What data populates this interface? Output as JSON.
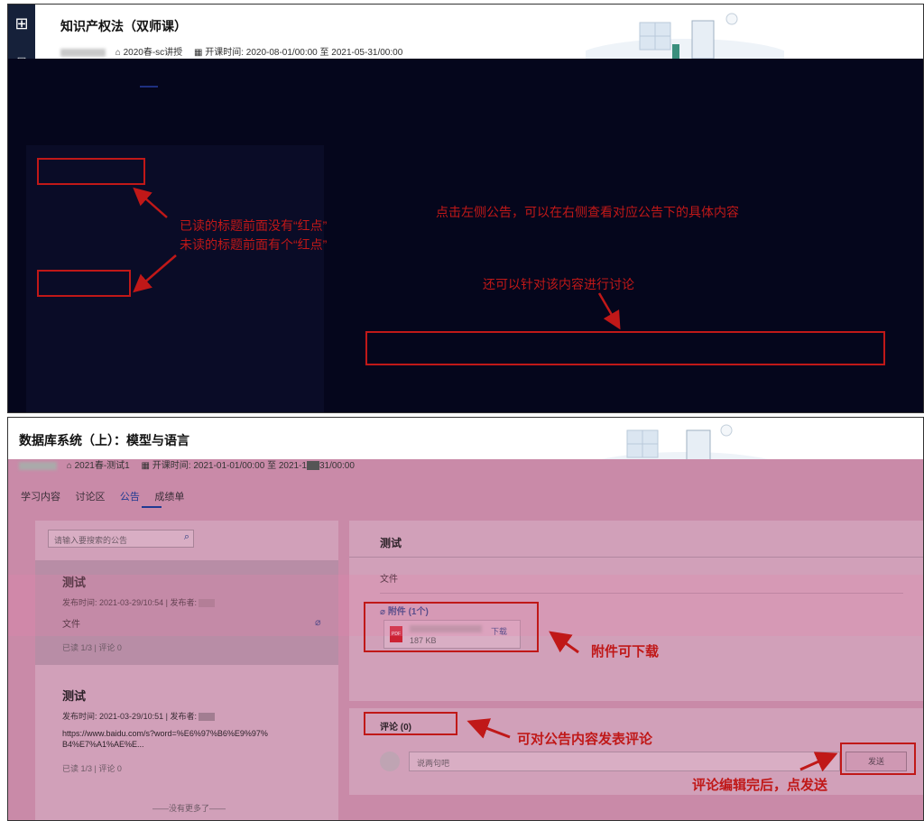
{
  "top_panel": {
    "course_title": "知识产权法（双师课）",
    "term": "2020春-sc讲授",
    "time_label": "开课时间:",
    "time_start": "2020-08-01/00:00",
    "time_sep": "至",
    "time_end": "2021-05-31/00:00",
    "annotation_read": "已读的标题前面没有“红点”",
    "annotation_unread": "未读的标题前面有个“红点”",
    "annotation_right": "点击左侧公告，可以在右侧查看对应公告下的具体内容",
    "annotation_discuss": "还可以针对该内容进行讨论"
  },
  "bottom_panel": {
    "course_title": "数据库系统（上）：模型与语言",
    "term": "2021春-测试1",
    "time_label": "开课时间:",
    "time_start": "2021-01-01/00:00",
    "time_sep": "至",
    "time_end_fragment": "2021-1",
    "time_end_tail": "31/00:00",
    "tabs": [
      "学习内容",
      "讨论区",
      "公告",
      "成绩单"
    ],
    "active_tab": "公告",
    "search_placeholder": "请输入要搜索的公告",
    "announcements": [
      {
        "title": "测试",
        "time_label": "发布时间:",
        "time": "2021-03-29/10:54",
        "publisher_label": "发布者:",
        "body": "文件",
        "read": "已读 1/3",
        "comments": "评论 0"
      },
      {
        "title": "测试",
        "time_label": "发布时间:",
        "time": "2021-03-29/10:51",
        "publisher_label": "发布者:",
        "body": "https://www.baidu.com/s?word=%E6%97%B6%E9%97%B4%E7%A1%AE%E...",
        "read": "已读 1/3",
        "comments": "评论 0"
      }
    ],
    "no_more": "——没有更多了——",
    "detail": {
      "title": "测试",
      "body": "文件",
      "attachments_label": "附件 (1个)",
      "file_size": "187 KB",
      "download": "下载",
      "pdf_badge": "PDF",
      "comments_label": "评论 (0)",
      "comment_placeholder": "说两句吧",
      "send": "发送"
    },
    "annotation_download": "附件可下载",
    "annotation_comment": "可对公告内容发表评论",
    "annotation_send": "评论编辑完后，点发送"
  },
  "colors": {
    "annotation_red": "#c01818",
    "overlay_pink": "#c98aa8",
    "dark_overlay": "#05061c",
    "tab_active": "#1f3a92"
  }
}
